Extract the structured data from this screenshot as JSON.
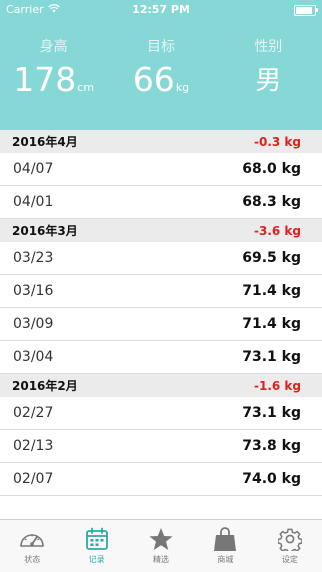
{
  "status_bar": {
    "carrier": "Carrier",
    "time": "12:57 PM"
  },
  "colors": {
    "header_bg": "#86d8d6",
    "accent": "#2ca9a4",
    "negative": "#e02020"
  },
  "header": {
    "stats": [
      {
        "label": "身高",
        "value": "178",
        "unit": "cm"
      },
      {
        "label": "目标",
        "value": "66",
        "unit": "kg"
      },
      {
        "label": "性别",
        "value": "男",
        "unit": ""
      }
    ]
  },
  "months": [
    {
      "title": "2016年4月",
      "change": "-0.3 kg",
      "entries": [
        {
          "date": "04/07",
          "weight": "68.0 kg"
        },
        {
          "date": "04/01",
          "weight": "68.3 kg"
        }
      ]
    },
    {
      "title": "2016年3月",
      "change": "-3.6 kg",
      "entries": [
        {
          "date": "03/23",
          "weight": "69.5 kg"
        },
        {
          "date": "03/16",
          "weight": "71.4 kg"
        },
        {
          "date": "03/09",
          "weight": "71.4 kg"
        },
        {
          "date": "03/04",
          "weight": "73.1 kg"
        }
      ]
    },
    {
      "title": "2016年2月",
      "change": "-1.6 kg",
      "entries": [
        {
          "date": "02/27",
          "weight": "73.1 kg"
        },
        {
          "date": "02/13",
          "weight": "73.8 kg"
        },
        {
          "date": "02/07",
          "weight": "74.0 kg"
        }
      ]
    }
  ],
  "tabs": [
    {
      "label": "状态",
      "icon": "gauge-icon",
      "active": false
    },
    {
      "label": "记录",
      "icon": "calendar-icon",
      "active": true
    },
    {
      "label": "精选",
      "icon": "star-icon",
      "active": false
    },
    {
      "label": "商城",
      "icon": "shopping-bag-icon",
      "active": false
    },
    {
      "label": "设定",
      "icon": "gear-icon",
      "active": false
    }
  ]
}
